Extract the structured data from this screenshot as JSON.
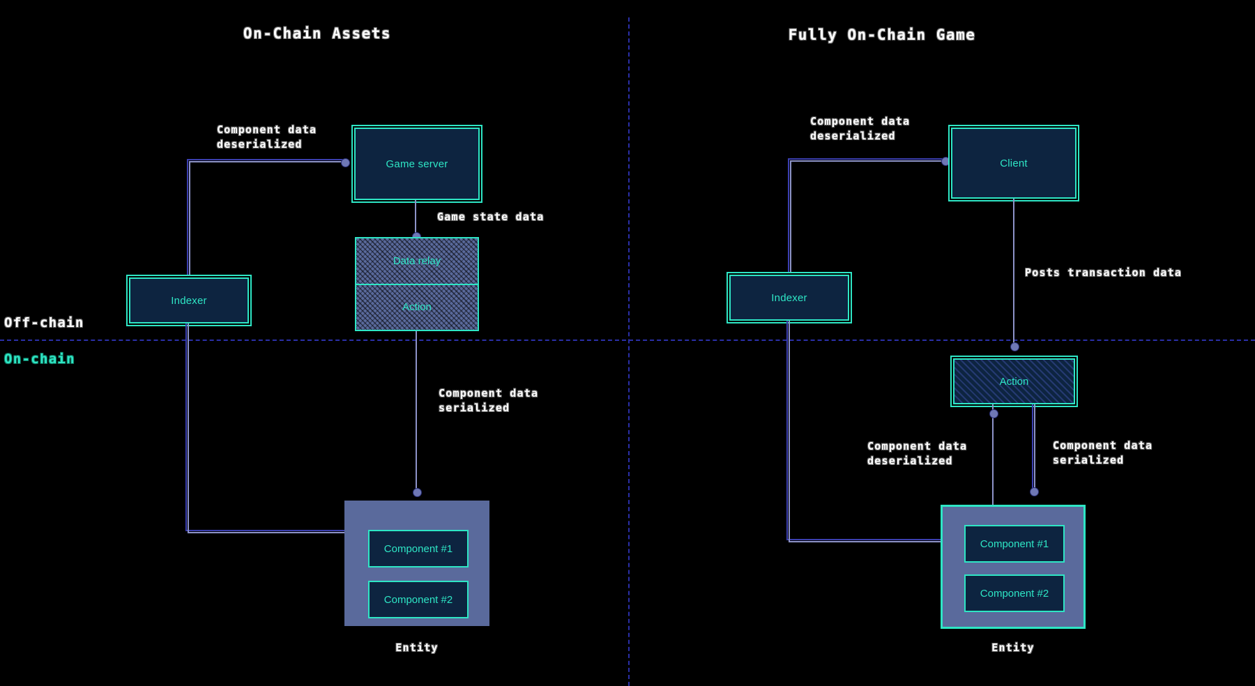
{
  "panels": {
    "left_title": "On-Chain Assets",
    "right_title": "Fully On-Chain Game"
  },
  "chain_labels": {
    "off": "Off-chain",
    "on": "On-chain"
  },
  "left": {
    "game_server": "Game server",
    "indexer": "Indexer",
    "data_relay": "Data relay",
    "action": "Action",
    "entity_caption": "Entity",
    "component_1": "Component #1",
    "component_2": "Component #2",
    "edges": {
      "component_data_deserialized": "Component data\ndeserialized",
      "game_state_data": "Game state data",
      "component_data_serialized": "Component data\nserialized"
    }
  },
  "right": {
    "client": "Client",
    "indexer": "Indexer",
    "action": "Action",
    "entity_caption": "Entity",
    "component_1": "Component #1",
    "component_2": "Component #2",
    "edges": {
      "component_data_deserialized_top": "Component data\ndeserialized",
      "posts_transaction_data": "Posts transaction data",
      "component_data_deserialized_bottom": "Component data\ndeserialized",
      "component_data_serialized": "Component data\nserialized"
    }
  },
  "colors": {
    "accent_teal": "#2ee6c5",
    "node_fill": "#0d2440",
    "entity_fill": "#5a6a9c",
    "edge_line": "#8d93c9",
    "divider": "#2a2fa8",
    "background": "#000000"
  }
}
